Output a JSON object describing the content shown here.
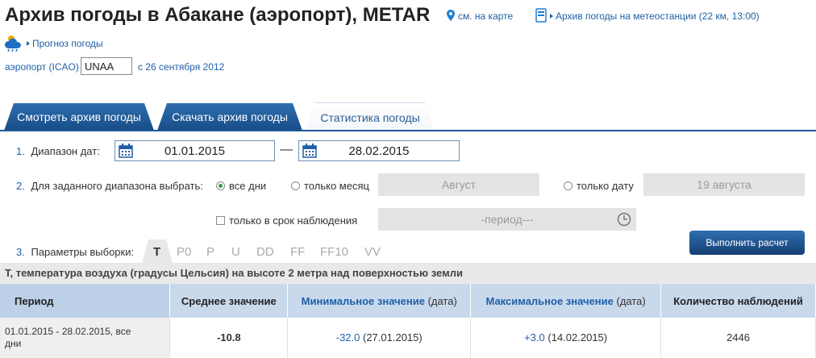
{
  "header": {
    "title": "Архив погоды в Абакане (аэропорт), METAR",
    "map_link": "см. на карте",
    "station_link": "Архив погоды на метеостанции (22 км, 13:00)",
    "forecast_link": "Прогноз погоды",
    "icao_label": "аэропорт (ICAO)",
    "icao_value": "UNAA",
    "since_link": "с 26 сентября 2012"
  },
  "tabs": [
    {
      "label": "Смотреть архив погоды"
    },
    {
      "label": "Скачать архив погоды"
    },
    {
      "label": "Статистика погоды"
    }
  ],
  "form": {
    "step1_num": "1.",
    "step1_label": "Диапазон дат:",
    "date_from": "01.01.2015",
    "date_sep": "—",
    "date_to": "28.02.2015",
    "step2_num": "2.",
    "step2_label": "Для заданного диапазона выбрать:",
    "opt_all_days": "все дни",
    "opt_month": "только месяц",
    "month_value": "Август",
    "opt_date": "только дату",
    "date_value": "19 августа",
    "opt_observation": "только в срок наблюдения",
    "period_placeholder": "-период---",
    "step3_num": "3.",
    "step3_label": "Параметры выборки:",
    "params": [
      "T",
      "P0",
      "P",
      "U",
      "DD",
      "FF",
      "FF10",
      "VV"
    ],
    "run_button": "Выполнить расчет"
  },
  "result": {
    "description": "T, температура воздуха (градусы Цельсия) на высоте 2 метра над поверхностью земли",
    "columns": {
      "period": "Период",
      "avg": "Среднее значение",
      "min": "Минимальное значение",
      "min_paren": "(дата)",
      "max": "Максимальное значение",
      "max_paren": "(дата)",
      "count": "Количество наблюдений"
    },
    "row": {
      "period_line1": "01.01.2015 - 28.02.2015, все",
      "period_line2": "дни",
      "avg": "-10.8",
      "min_value": "-32.0",
      "min_date": "(27.01.2015)",
      "max_value": "+3.0",
      "max_date": "(14.02.2015)",
      "count": "2446"
    }
  }
}
